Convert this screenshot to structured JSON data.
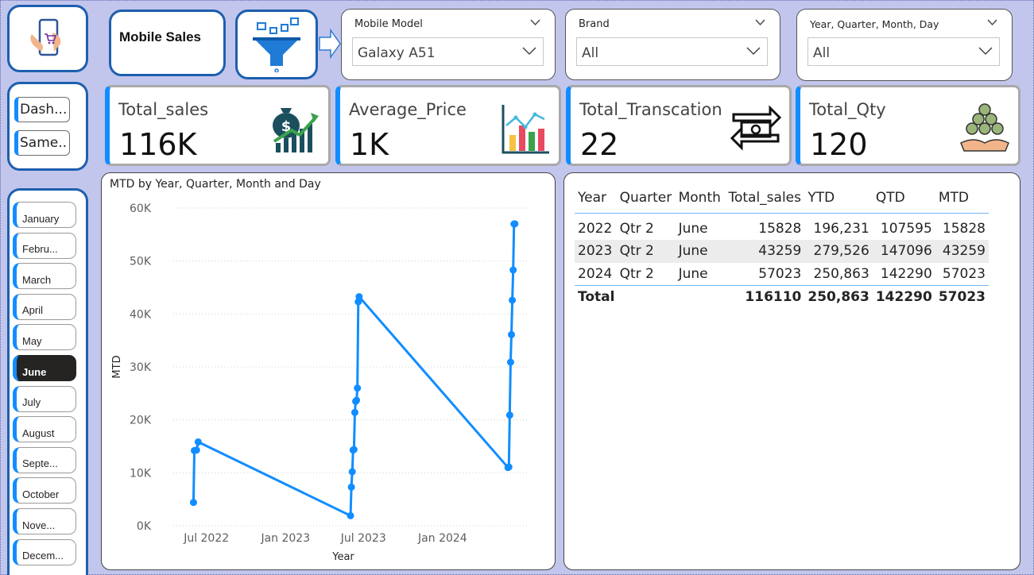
{
  "header": {
    "title": "Mobile Sales"
  },
  "nav": {
    "buttons": [
      {
        "label": "Dash..."
      },
      {
        "label": "Same.."
      }
    ]
  },
  "slicers": {
    "model": {
      "label": "Mobile Model",
      "value": "Galaxy A51"
    },
    "brand": {
      "label": "Brand",
      "value": "All"
    },
    "date": {
      "label": "Year, Quarter, Month, Day",
      "value": "All"
    }
  },
  "months": [
    {
      "label": "January",
      "active": false
    },
    {
      "label": "Febru...",
      "active": false
    },
    {
      "label": "March",
      "active": false
    },
    {
      "label": "April",
      "active": false
    },
    {
      "label": "May",
      "active": false
    },
    {
      "label": "June",
      "active": true
    },
    {
      "label": "July",
      "active": false
    },
    {
      "label": "August",
      "active": false
    },
    {
      "label": "Septe...",
      "active": false
    },
    {
      "label": "October",
      "active": false
    },
    {
      "label": "Nove...",
      "active": false
    },
    {
      "label": "Decem...",
      "active": false
    }
  ],
  "kpis": [
    {
      "label": "Total_sales",
      "value": "116K",
      "icon": "money-bag-growth-icon"
    },
    {
      "label": "Average_Price",
      "value": "1K",
      "icon": "bar-chart-icon"
    },
    {
      "label": "Total_Transcation",
      "value": "22",
      "icon": "cash-exchange-icon"
    },
    {
      "label": "Total_Qty",
      "value": "120",
      "icon": "coins-hand-icon"
    }
  ],
  "colors": {
    "accent": "#118dff",
    "border_blue": "#1d5fae",
    "background": "#c2c6ec"
  },
  "chart_data": {
    "type": "line",
    "title": "MTD by Year, Quarter, Month and Day",
    "xlabel": "Year",
    "ylabel": "MTD",
    "x_ticks": [
      "Jul 2022",
      "Jan 2023",
      "Jul 2023",
      "Jan 2024"
    ],
    "y_ticks": [
      "0K",
      "10K",
      "20K",
      "30K",
      "40K",
      "50K",
      "60K"
    ],
    "ylim": [
      0,
      60000
    ],
    "grid": true,
    "series": [
      {
        "color": "#118dff",
        "points": [
          {
            "x": "2022-06-01",
            "y": 4400
          },
          {
            "x": "2022-06-03",
            "y": 14200
          },
          {
            "x": "2022-06-08",
            "y": 14300
          },
          {
            "x": "2022-06-12",
            "y": 15828
          },
          {
            "x": "2023-06-01",
            "y": 1900
          },
          {
            "x": "2023-06-03",
            "y": 7300
          },
          {
            "x": "2023-06-05",
            "y": 10200
          },
          {
            "x": "2023-06-07",
            "y": 14300
          },
          {
            "x": "2023-06-09",
            "y": 14400
          },
          {
            "x": "2023-06-11",
            "y": 21400
          },
          {
            "x": "2023-06-13",
            "y": 23500
          },
          {
            "x": "2023-06-15",
            "y": 23700
          },
          {
            "x": "2023-06-17",
            "y": 26000
          },
          {
            "x": "2023-06-19",
            "y": 42300
          },
          {
            "x": "2023-06-21",
            "y": 43259
          },
          {
            "x": "2024-06-01",
            "y": 11000
          },
          {
            "x": "2024-06-03",
            "y": 11100
          },
          {
            "x": "2024-06-05",
            "y": 20900
          },
          {
            "x": "2024-06-07",
            "y": 30900
          },
          {
            "x": "2024-06-09",
            "y": 36100
          },
          {
            "x": "2024-06-11",
            "y": 42600
          },
          {
            "x": "2024-06-13",
            "y": 48300
          },
          {
            "x": "2024-06-15",
            "y": 57000
          },
          {
            "x": "2024-06-17",
            "y": 57023
          }
        ]
      }
    ]
  },
  "table": {
    "headers": [
      "Year",
      "Quarter",
      "Month",
      "Total_sales",
      "YTD",
      "QTD",
      "MTD"
    ],
    "rows": [
      [
        "2022",
        "Qtr 2",
        "June",
        "15828",
        "196,231",
        "107595",
        "15828"
      ],
      [
        "2023",
        "Qtr 2",
        "June",
        "43259",
        "279,526",
        "147096",
        "43259"
      ],
      [
        "2024",
        "Qtr 2",
        "June",
        "57023",
        "250,863",
        "142290",
        "57023"
      ]
    ],
    "total": [
      "Total",
      "116110",
      "250,863",
      "142290",
      "57023"
    ]
  }
}
